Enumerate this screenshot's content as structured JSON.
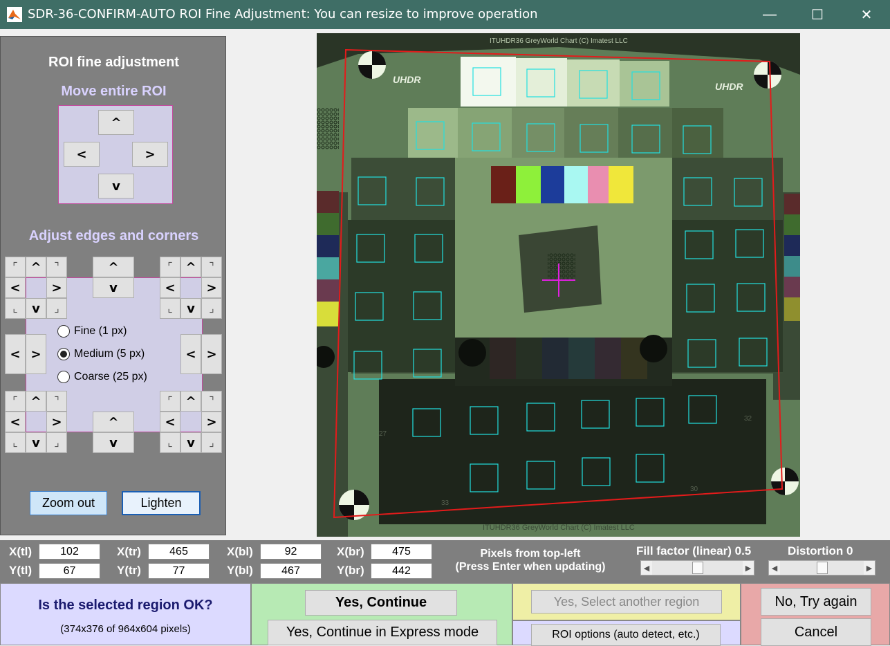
{
  "window": {
    "title": "SDR-36-CONFIRM-AUTO ROI Fine Adjustment: You can resize to improve operation",
    "minimize": "—",
    "maximize": "☐",
    "close": "✕"
  },
  "left_panel": {
    "title": "ROI fine adjustment",
    "move_heading": "Move entire ROI",
    "edges_heading": "Adjust edges and corners",
    "arrows": {
      "up": "^",
      "down": "v",
      "left": "<",
      "right": ">",
      "corner_tl": "⌜",
      "corner_tr": "⌝",
      "corner_bl": "⌞",
      "corner_br": "⌟"
    },
    "step_options": [
      {
        "label": "Fine (1 px)",
        "selected": false
      },
      {
        "label": "Medium (5 px)",
        "selected": true
      },
      {
        "label": "Coarse (25 px)",
        "selected": false
      }
    ],
    "zoom_out_label": "Zoom out",
    "lighten_label": "Lighten"
  },
  "image": {
    "top_caption": "ITUHDR36 GreyWorld Chart (C) Imatest LLC",
    "bottom_caption": "ITUHDR36 GreyWorld Chart (C) Imatest LLC",
    "logo_left": "UHDR",
    "logo_right": "UHDR",
    "num_a": "33",
    "num_b": "27",
    "num_c": "32",
    "num_d": "30"
  },
  "coords": {
    "xtl_label": "X(tl)",
    "xtl": "102",
    "ytl_label": "Y(tl)",
    "ytl": "67",
    "xtr_label": "X(tr)",
    "xtr": "465",
    "ytr_label": "Y(tr)",
    "ytr": "77",
    "xbl_label": "X(bl)",
    "xbl": "92",
    "ybl_label": "Y(bl)",
    "ybl": "467",
    "xbr_label": "X(br)",
    "xbr": "475",
    "ybr_label": "Y(br)",
    "ybr": "442",
    "note_line1": "Pixels from top-left",
    "note_line2": "(Press Enter when updating)",
    "fill_factor_label": "Fill factor (linear) 0.5",
    "fill_factor_value": 0.5,
    "distortion_label": "Distortion 0",
    "distortion_value": 0.5
  },
  "bottom": {
    "question": "Is the selected region OK?",
    "size_info": "(374x376 of 964x604 pixels)",
    "yes_continue": "Yes, Continue",
    "yes_express": "Yes, Continue in Express mode",
    "yes_another": "Yes, Select another region",
    "roi_options": "ROI options (auto detect, etc.)",
    "no_try_again": "No, Try again",
    "cancel": "Cancel"
  },
  "colors": {
    "titlebar": "#3f6e66",
    "roi_outline": "#e31b1b",
    "patch_outline": "#22e0e0",
    "crosshair": "#e020e0",
    "panel_box": "#d0cee6",
    "yes_bg": "#b7eab4",
    "another_bg": "#efefa6",
    "no_bg": "#e8a8a8",
    "question_bg": "#dcdaff"
  }
}
